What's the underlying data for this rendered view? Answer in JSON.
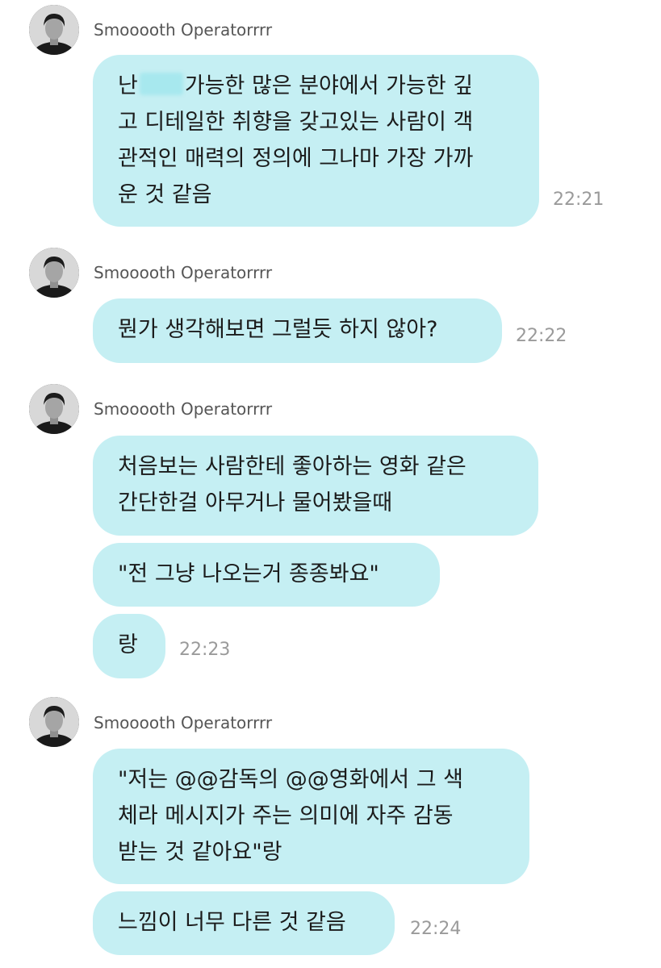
{
  "groups": [
    {
      "sender": "Smooooth Operatorrrr",
      "messages": [
        {
          "lines": [
            "난",
            "가능한 많은 분야에서 가능한 깊",
            "고 디테일한 취향을 갖고있는 사람이 객",
            "관적인 매력의 정의에 그나마 가장 가까",
            "운 것 같음"
          ]
        }
      ],
      "time": "22:21"
    },
    {
      "sender": "Smooooth Operatorrrr",
      "messages": [
        {
          "lines": [
            "뭔가 생각해보면 그럴듯 하지 않아?"
          ]
        }
      ],
      "time": "22:22"
    },
    {
      "sender": "Smooooth Operatorrrr",
      "messages": [
        {
          "lines": [
            "처음보는 사람한테 좋아하는 영화 같은",
            "간단한걸 아무거나 물어봤을때"
          ]
        },
        {
          "lines": [
            "\"전 그냥 나오는거 종종봐요\""
          ]
        },
        {
          "lines": [
            "랑"
          ]
        }
      ],
      "time": "22:23"
    },
    {
      "sender": "Smooooth Operatorrrr",
      "messages": [
        {
          "lines": [
            "\"저는 @@감독의 @@영화에서 그 색",
            "체라 메시지가 주는 의미에 자주 감동",
            "받는 것 같아요\"랑"
          ]
        },
        {
          "lines": [
            "느낌이 너무 다른 것 같음"
          ]
        }
      ],
      "time": "22:24"
    }
  ],
  "colors": {
    "bubble": "#c5eff3",
    "text": "#1b1b1b",
    "time": "#9a9a9a",
    "sender": "#555555"
  },
  "icons": {
    "avatar": "profile-photo"
  }
}
